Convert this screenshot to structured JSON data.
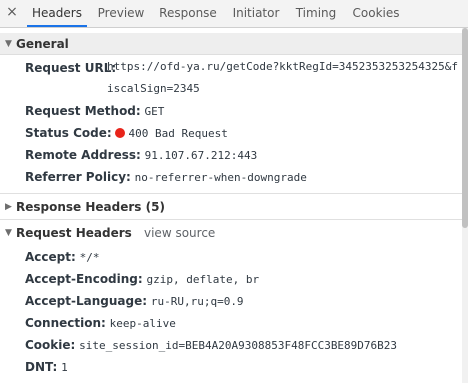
{
  "tabs": [
    {
      "label": "Headers",
      "active": true
    },
    {
      "label": "Preview"
    },
    {
      "label": "Response"
    },
    {
      "label": "Initiator"
    },
    {
      "label": "Timing"
    },
    {
      "label": "Cookies"
    }
  ],
  "close_glyph": "×",
  "general": {
    "title": "General",
    "request_url_key": "Request URL:",
    "request_url_value": "https://ofd-ya.ru/getCode?kktRegId=3452353253254325&fiscalSign=2345",
    "request_method_key": "Request Method:",
    "request_method_value": "GET",
    "status_code_key": "Status Code:",
    "status_code_value": "400 Bad Request",
    "status_color": "#e8241a",
    "remote_address_key": "Remote Address:",
    "remote_address_value": "91.107.67.212:443",
    "referrer_policy_key": "Referrer Policy:",
    "referrer_policy_value": "no-referrer-when-downgrade"
  },
  "response_headers": {
    "title": "Response Headers (5)"
  },
  "request_headers": {
    "title": "Request Headers",
    "view_source": "view source",
    "items": [
      {
        "key": "Accept:",
        "value": "*/*"
      },
      {
        "key": "Accept-Encoding:",
        "value": "gzip, deflate, br"
      },
      {
        "key": "Accept-Language:",
        "value": "ru-RU,ru;q=0.9"
      },
      {
        "key": "Connection:",
        "value": "keep-alive"
      },
      {
        "key": "Cookie:",
        "value": "site_session_id=BEB4A20A9308853F48FCC3BE89D76B23"
      },
      {
        "key": "DNT:",
        "value": "1"
      }
    ]
  }
}
